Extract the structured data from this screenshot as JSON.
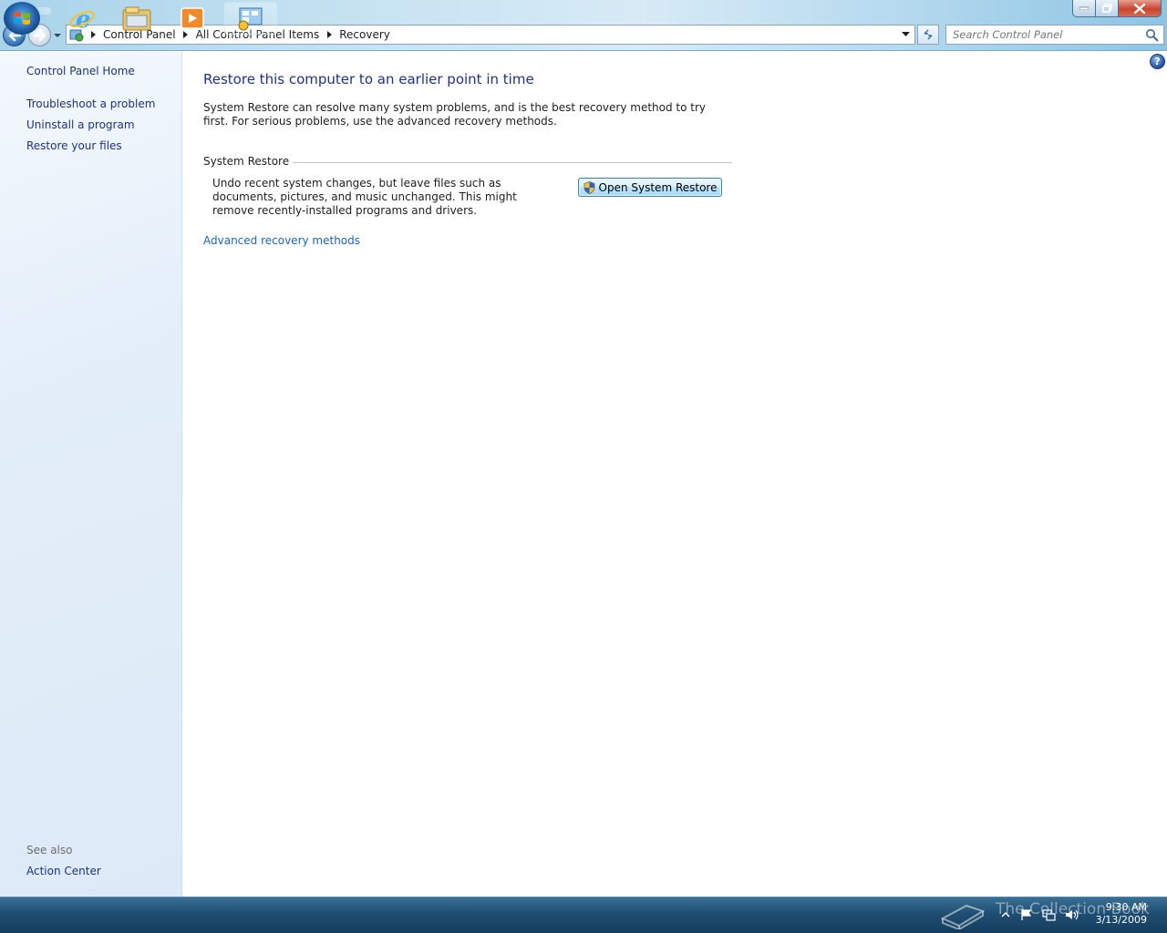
{
  "window": {
    "search_placeholder": "Search Control Panel",
    "help_label": "?"
  },
  "breadcrumb": [
    "Control Panel",
    "All Control Panel Items",
    "Recovery"
  ],
  "sidebar": {
    "home": "Control Panel Home",
    "items": [
      "Troubleshoot a problem",
      "Uninstall a program",
      "Restore your files"
    ],
    "see_also_label": "See also",
    "see_also_items": [
      "Action Center"
    ]
  },
  "main": {
    "title": "Restore this computer to an earlier point in time",
    "intro": "System Restore can resolve many system problems, and is the best recovery method to try first. For serious problems, use the advanced recovery methods.",
    "section_title": "System Restore",
    "restore_description": "Undo recent system changes, but leave files such as documents, pictures, and music unchanged. This might remove recently-installed programs and drivers.",
    "open_restore_button": "Open System Restore",
    "advanced_link": "Advanced recovery methods"
  },
  "taskbar": {
    "apps": [
      "internet-explorer-icon",
      "windows-explorer-icon",
      "media-player-icon",
      "control-panel-icon"
    ],
    "watermark": "The Collection Book",
    "clock_time": "9:30 AM",
    "clock_date": "3/13/2009"
  },
  "colors": {
    "link": "#1e3287",
    "link_blue": "#1e64b4",
    "title": "#1e3287"
  }
}
